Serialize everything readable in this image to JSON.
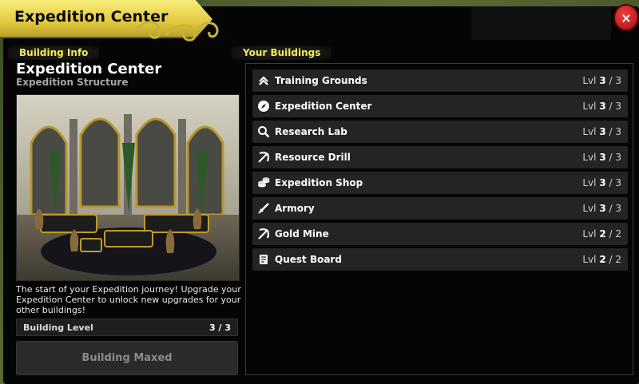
{
  "header": {
    "title": "Expedition Center",
    "close_label": "×"
  },
  "building_info": {
    "tab_label": "Building Info",
    "title": "Expedition Center",
    "subtitle": "Expedition Structure",
    "description": "The start of your Expedition journey! Upgrade your Expedition Center to unlock new upgrades for your other buildings!",
    "level_label": "Building Level",
    "level_value": "3 / 3",
    "maxed_button": "Building Maxed"
  },
  "your_buildings": {
    "tab_label": "Your Buildings",
    "lvl_prefix": "Lvl",
    "items": [
      {
        "name": "Training Grounds",
        "level": "3",
        "max": "/ 3",
        "icon": "chevrons-up-icon"
      },
      {
        "name": "Expedition Center",
        "level": "3",
        "max": "/ 3",
        "icon": "compass-icon"
      },
      {
        "name": "Research Lab",
        "level": "3",
        "max": "/ 3",
        "icon": "magnifier-icon"
      },
      {
        "name": "Resource Drill",
        "level": "3",
        "max": "/ 3",
        "icon": "pickaxe-icon"
      },
      {
        "name": "Expedition Shop",
        "level": "3",
        "max": "/ 3",
        "icon": "coins-icon"
      },
      {
        "name": "Armory",
        "level": "3",
        "max": "/ 3",
        "icon": "sword-icon"
      },
      {
        "name": "Gold Mine",
        "level": "2",
        "max": "/ 2",
        "icon": "pickaxe-icon"
      },
      {
        "name": "Quest Board",
        "level": "2",
        "max": "/ 2",
        "icon": "scroll-icon"
      }
    ]
  },
  "colors": {
    "title_banner": "#f2e25a",
    "tab_text": "#f1e95c",
    "close_button": "#c81e1e",
    "row_bg": "#242424"
  }
}
